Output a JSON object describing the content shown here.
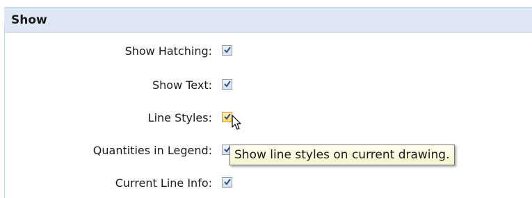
{
  "section": {
    "title": "Show"
  },
  "rows": [
    {
      "label": "Show Hatching:",
      "checked": true
    },
    {
      "label": "Show Text:",
      "checked": true
    },
    {
      "label": "Line Styles:",
      "checked": true,
      "hovered": true
    },
    {
      "label": "Quantities in Legend:",
      "checked": true
    },
    {
      "label": "Current Line Info:",
      "checked": true
    }
  ],
  "tooltip": {
    "text": "Show line styles on current drawing."
  },
  "colors": {
    "header_bg": "#dde8f4",
    "checkmark": "#2b4f8a",
    "hover_checkbox": "#fbd96a",
    "tooltip_bg": "#fffff0"
  },
  "icons": {
    "checkmark": "checkmark-icon",
    "cursor": "pointer-cursor-icon"
  }
}
